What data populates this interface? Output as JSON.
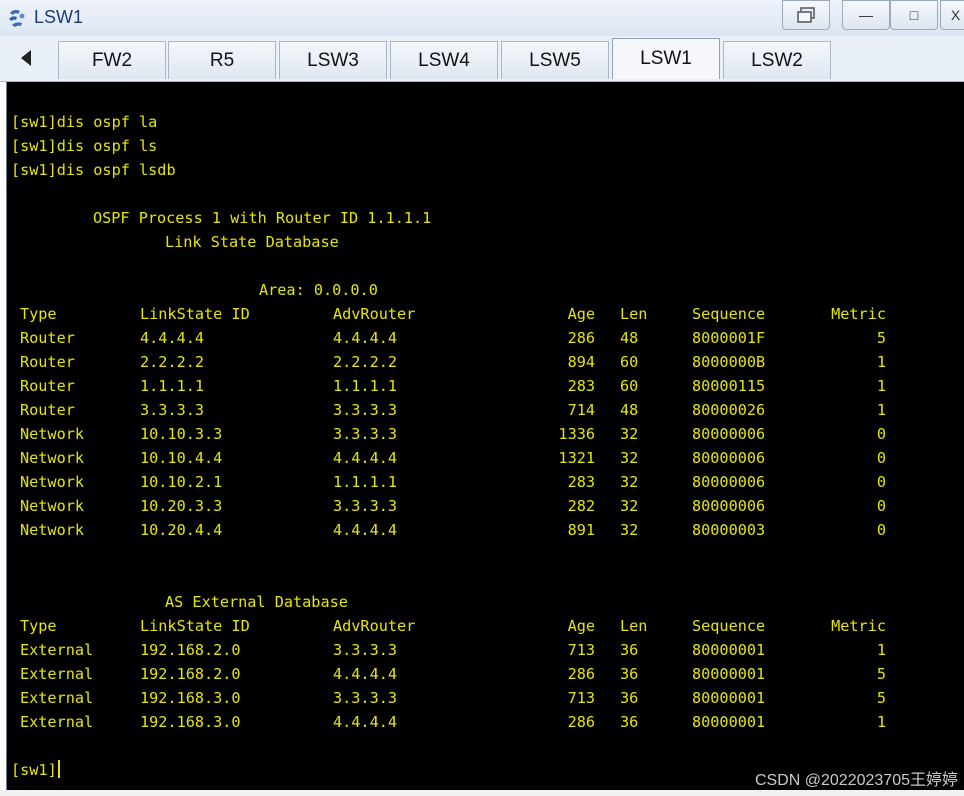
{
  "window": {
    "title": "LSW1",
    "restore_label": "",
    "minimize_label": "—",
    "maximize_label": "□",
    "close_label": "X"
  },
  "tabs": [
    {
      "label": "FW2",
      "active": false
    },
    {
      "label": "R5",
      "active": false
    },
    {
      "label": "LSW3",
      "active": false
    },
    {
      "label": "LSW4",
      "active": false
    },
    {
      "label": "LSW5",
      "active": false
    },
    {
      "label": "LSW1",
      "active": true
    },
    {
      "label": "LSW2",
      "active": false
    }
  ],
  "terminal": {
    "text_color": "#e6e600",
    "background": "#000000",
    "commands": [
      "[sw1]dis ospf la",
      "[sw1]dis ospf ls",
      "[sw1]dis ospf lsdb"
    ],
    "process_header": "OSPF Process 1 with Router ID 1.1.1.1",
    "database_title": "Link State Database",
    "area_line": "Area: 0.0.0.0",
    "columns": [
      "Type",
      "LinkState ID",
      "AdvRouter",
      "Age",
      "Len",
      "Sequence",
      "Metric"
    ],
    "area_rows": [
      [
        "Router",
        "4.4.4.4",
        "4.4.4.4",
        "286",
        "48",
        "8000001F",
        "5"
      ],
      [
        "Router",
        "2.2.2.2",
        "2.2.2.2",
        "894",
        "60",
        "8000000B",
        "1"
      ],
      [
        "Router",
        "1.1.1.1",
        "1.1.1.1",
        "283",
        "60",
        "80000115",
        "1"
      ],
      [
        "Router",
        "3.3.3.3",
        "3.3.3.3",
        "714",
        "48",
        "80000026",
        "1"
      ],
      [
        "Network",
        "10.10.3.3",
        "3.3.3.3",
        "1336",
        "32",
        "80000006",
        "0"
      ],
      [
        "Network",
        "10.10.4.4",
        "4.4.4.4",
        "1321",
        "32",
        "80000006",
        "0"
      ],
      [
        "Network",
        "10.10.2.1",
        "1.1.1.1",
        "283",
        "32",
        "80000006",
        "0"
      ],
      [
        "Network",
        "10.20.3.3",
        "3.3.3.3",
        "282",
        "32",
        "80000006",
        "0"
      ],
      [
        "Network",
        "10.20.4.4",
        "4.4.4.4",
        "891",
        "32",
        "80000003",
        "0"
      ]
    ],
    "external_title": "AS External Database",
    "external_rows": [
      [
        "External",
        "192.168.2.0",
        "3.3.3.3",
        "713",
        "36",
        "80000001",
        "1"
      ],
      [
        "External",
        "192.168.2.0",
        "4.4.4.4",
        "286",
        "36",
        "80000001",
        "5"
      ],
      [
        "External",
        "192.168.3.0",
        "3.3.3.3",
        "713",
        "36",
        "80000001",
        "5"
      ],
      [
        "External",
        "192.168.3.0",
        "4.4.4.4",
        "286",
        "36",
        "80000001",
        "1"
      ]
    ],
    "prompt": "[sw1]"
  },
  "watermark": "CSDN @2022023705王婷婷"
}
